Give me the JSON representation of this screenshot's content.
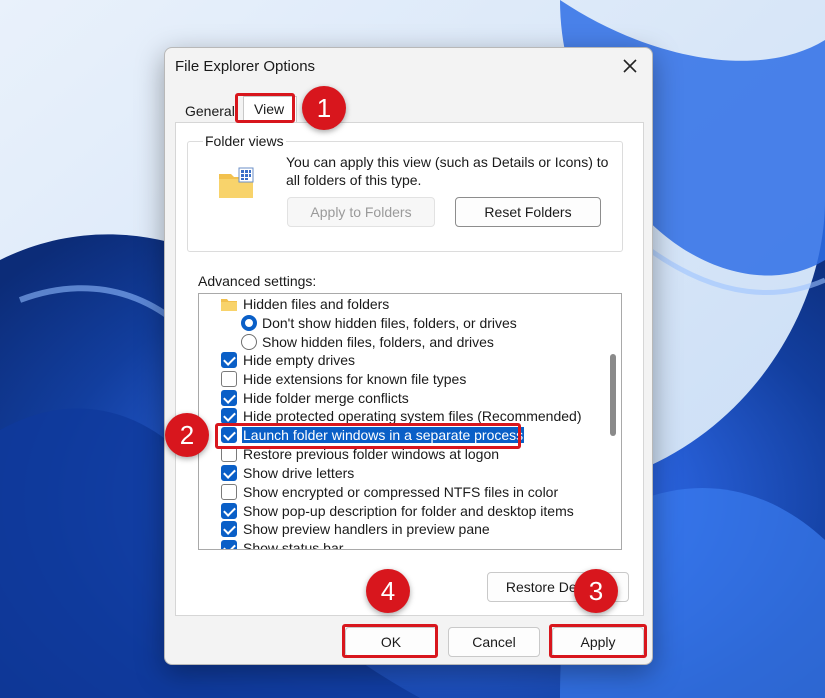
{
  "dialog": {
    "title": "File Explorer Options",
    "tabs": [
      "General",
      "View"
    ],
    "active_tab": "View"
  },
  "folder_views": {
    "label": "Folder views",
    "description": "You can apply this view (such as Details or Icons) to all folders of this type.",
    "apply_button": "Apply to Folders",
    "reset_button": "Reset Folders"
  },
  "advanced": {
    "label": "Advanced settings:",
    "items": [
      {
        "type": "folder",
        "label": "Hidden files and folders"
      },
      {
        "type": "radio",
        "label": "Don't show hidden files, folders, or drives",
        "selected": true
      },
      {
        "type": "radio",
        "label": "Show hidden files, folders, and drives",
        "selected": false
      },
      {
        "type": "checkbox",
        "label": "Hide empty drives",
        "checked": true
      },
      {
        "type": "checkbox",
        "label": "Hide extensions for known file types",
        "checked": false
      },
      {
        "type": "checkbox",
        "label": "Hide folder merge conflicts",
        "checked": true
      },
      {
        "type": "checkbox",
        "label": "Hide protected operating system files (Recommended)",
        "checked": true
      },
      {
        "type": "checkbox",
        "label": "Launch folder windows in a separate process",
        "checked": true,
        "highlighted": true
      },
      {
        "type": "checkbox",
        "label": "Restore previous folder windows at logon",
        "checked": false
      },
      {
        "type": "checkbox",
        "label": "Show drive letters",
        "checked": true
      },
      {
        "type": "checkbox",
        "label": "Show encrypted or compressed NTFS files in color",
        "checked": false
      },
      {
        "type": "checkbox",
        "label": "Show pop-up description for folder and desktop items",
        "checked": true
      },
      {
        "type": "checkbox",
        "label": "Show preview handlers in preview pane",
        "checked": true
      },
      {
        "type": "checkbox",
        "label": "Show status bar",
        "checked": true
      }
    ]
  },
  "buttons": {
    "restore_defaults": "Restore Defaults",
    "ok": "OK",
    "cancel": "Cancel",
    "apply": "Apply"
  },
  "step_markers": [
    "1",
    "2",
    "3",
    "4"
  ],
  "colors": {
    "accent": "#0a5fc7",
    "marker": "#d8161d"
  }
}
